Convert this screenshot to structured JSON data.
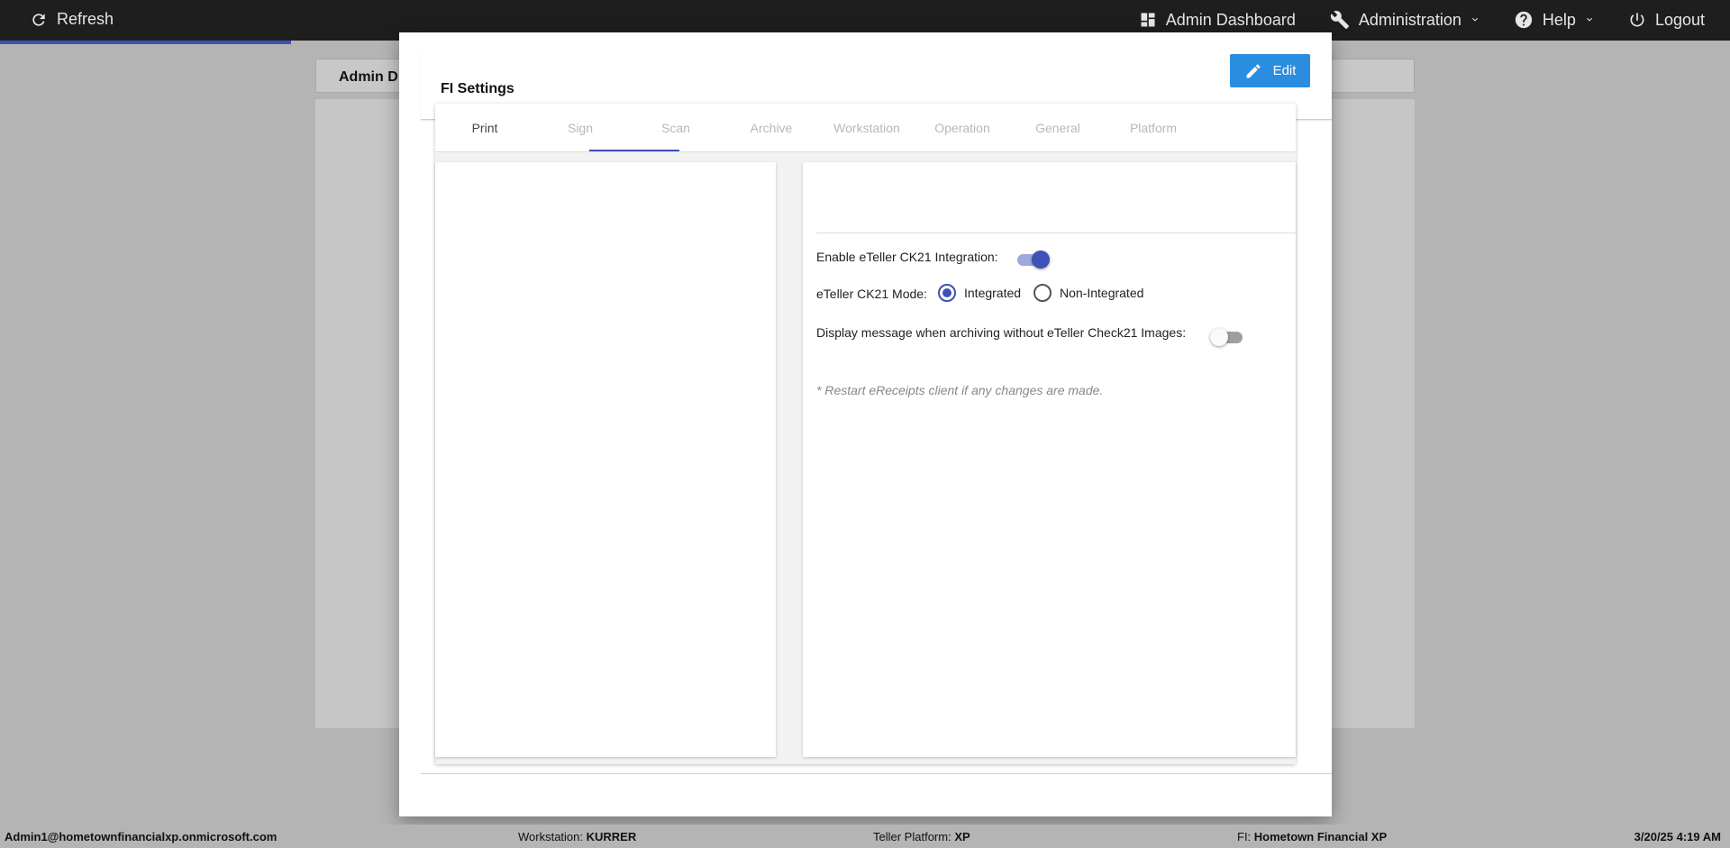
{
  "topbar": {
    "refresh": "Refresh",
    "admin_dashboard": "Admin Dashboard",
    "administration": "Administration",
    "help": "Help",
    "logout": "Logout"
  },
  "background": {
    "header_title": "Admin D"
  },
  "modal": {
    "title": "FI Settings",
    "edit_label": "Edit",
    "tabs": [
      {
        "label": "Print",
        "active": true
      },
      {
        "label": "Sign",
        "active": false
      },
      {
        "label": "Scan",
        "active": false
      },
      {
        "label": "Archive",
        "active": false
      },
      {
        "label": "Workstation",
        "active": false
      },
      {
        "label": "Operation",
        "active": false
      },
      {
        "label": "General",
        "active": false
      },
      {
        "label": "Platform",
        "active": false
      }
    ],
    "settings": {
      "enable_ck21_label": "Enable eTeller CK21 Integration:",
      "enable_ck21_on": true,
      "mode_label": "eTeller CK21 Mode:",
      "mode_options": [
        "Integrated",
        "Non-Integrated"
      ],
      "mode_selected": "Integrated",
      "display_msg_label": "Display message when archiving without eTeller Check21 Images:",
      "display_msg_on": false,
      "note": "* Restart eReceipts client if any changes are made."
    }
  },
  "status_bar": {
    "user": "Admin1@hometownfinancialxp.onmicrosoft.com",
    "workstation_label": "Workstation: ",
    "workstation": "KURRER",
    "platform_label": "Teller Platform: ",
    "platform": "XP",
    "fi_label": "FI: ",
    "fi": "Hometown Financial XP",
    "datetime": "3/20/25 4:19 AM"
  },
  "colors": {
    "accent": "#3f51b5",
    "edit_button": "#2b8de0",
    "topbar": "#1e1e1e"
  },
  "icons": [
    "refresh-icon",
    "dashboard-icon",
    "wrench-icon",
    "help-icon",
    "power-icon",
    "pencil-icon",
    "chevron-down-icon"
  ]
}
